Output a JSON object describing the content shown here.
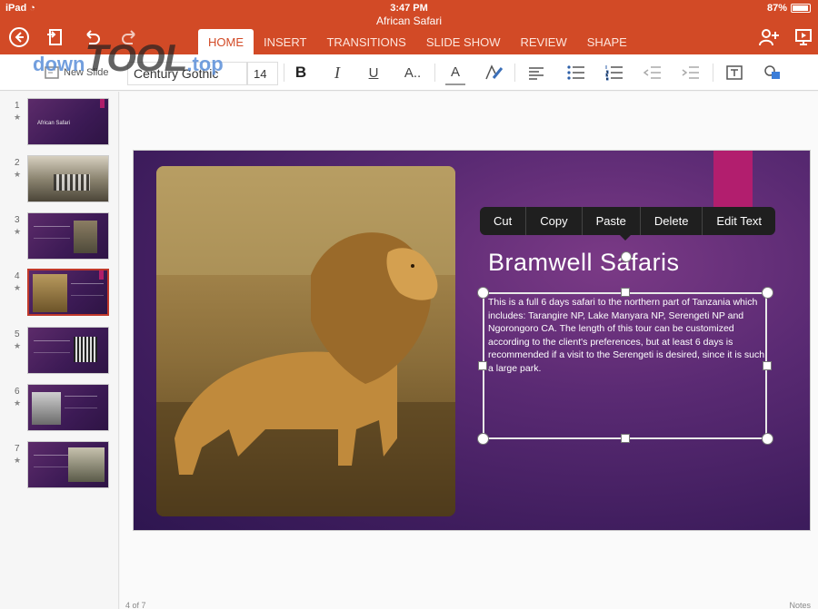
{
  "status": {
    "device": "iPad",
    "time": "3:47 PM",
    "battery": "87%"
  },
  "document": {
    "title": "African Safari"
  },
  "tabs": [
    {
      "label": "HOME",
      "active": true
    },
    {
      "label": "INSERT"
    },
    {
      "label": "TRANSITIONS"
    },
    {
      "label": "SLIDE SHOW"
    },
    {
      "label": "REVIEW"
    },
    {
      "label": "SHAPE"
    }
  ],
  "ribbon": {
    "new_slide": "New Slide",
    "font": "Century Gothic",
    "size": "14",
    "bold": "B",
    "italic": "I",
    "underline": "U",
    "more_format": "A..",
    "font_color": "A"
  },
  "watermark": {
    "a": "down",
    "b": "TOOL",
    "c": ".top"
  },
  "slides": [
    {
      "num": "1",
      "title": "African Safari"
    },
    {
      "num": "2"
    },
    {
      "num": "3"
    },
    {
      "num": "4",
      "selected": true
    },
    {
      "num": "5"
    },
    {
      "num": "6"
    },
    {
      "num": "7"
    }
  ],
  "slide": {
    "title": "Bramwell Safaris",
    "body": "This is a full 6 days safari to the northern part of Tanzania which includes: Tarangire NP, Lake Manyara NP, Serengeti NP and Ngorongoro CA. The length of this tour can be customized according to the client's preferences, but at least 6 days is recommended if a visit to the Serengeti is desired, since it is such a large park."
  },
  "context_menu": [
    "Cut",
    "Copy",
    "Paste",
    "Delete",
    "Edit Text"
  ],
  "footer": {
    "page": "4 of 7",
    "notes": "Notes"
  },
  "colors": {
    "accent": "#d24a26",
    "slide_pink": "#b21e6e"
  }
}
